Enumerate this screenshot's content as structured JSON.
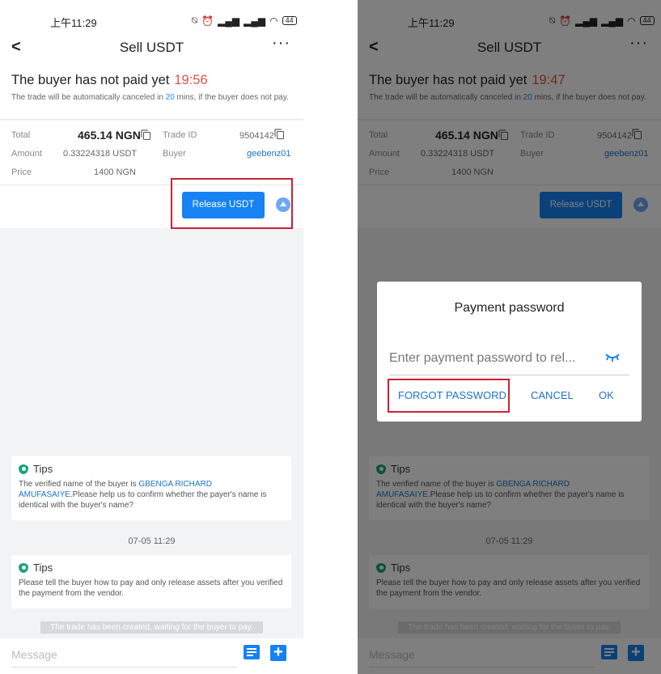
{
  "status_bar": {
    "time": "上午11:29",
    "battery": "44"
  },
  "nav": {
    "back": "<",
    "title": "Sell USDT",
    "more": "···"
  },
  "order_status": {
    "headline": "The buyer has not paid yet",
    "countdown_left": "19:56",
    "countdown_right": "19:47",
    "note_prefix": "The trade will be automatically canceled in ",
    "note_minutes": "20",
    "note_suffix": " mins, if the buyer does not pay."
  },
  "order_info": {
    "total_label": "Total",
    "total_value": "465.14 NGN",
    "amount_label": "Amount",
    "amount_value": "0.33224318 USDT",
    "price_label": "Price",
    "price_value": "1400 NGN",
    "trade_id_label": "Trade ID",
    "trade_id_value": "9504142",
    "buyer_label": "Buyer",
    "buyer_value": "geebenz01"
  },
  "actions": {
    "release_label": "Release USDT"
  },
  "chat": {
    "tips1_title": "Tips",
    "tips1_prefix": "The verified name of the buyer is ",
    "tips1_name": "GBENGA RICHARD AMUFASAIYE",
    "tips1_suffix": ".Please help us to confirm whether the payer's name is identical with the buyer's name?",
    "date": "07-05 11:29",
    "tips2_title": "Tips",
    "tips2_body": "Please tell the buyer how to pay and only release assets after you verified the payment from the vendor.",
    "system_message": "The trade has been created, waiting for the buyer to pay."
  },
  "message_bar": {
    "placeholder": "Message"
  },
  "dialog": {
    "title": "Payment password",
    "input_placeholder": "Enter payment password to rel...",
    "forgot_label": "FORGOT PASSWORD",
    "cancel_label": "CANCEL",
    "ok_label": "OK"
  },
  "colors": {
    "accent": "#1682f3",
    "countdown": "#e0524a",
    "highlight": "#c82333",
    "link": "#1a73c8"
  },
  "icons": [
    "chevron-left-icon",
    "more-icon",
    "copy-icon",
    "expand-up-icon",
    "shield-icon",
    "list-icon",
    "plus-icon",
    "eye-closed-icon"
  ]
}
